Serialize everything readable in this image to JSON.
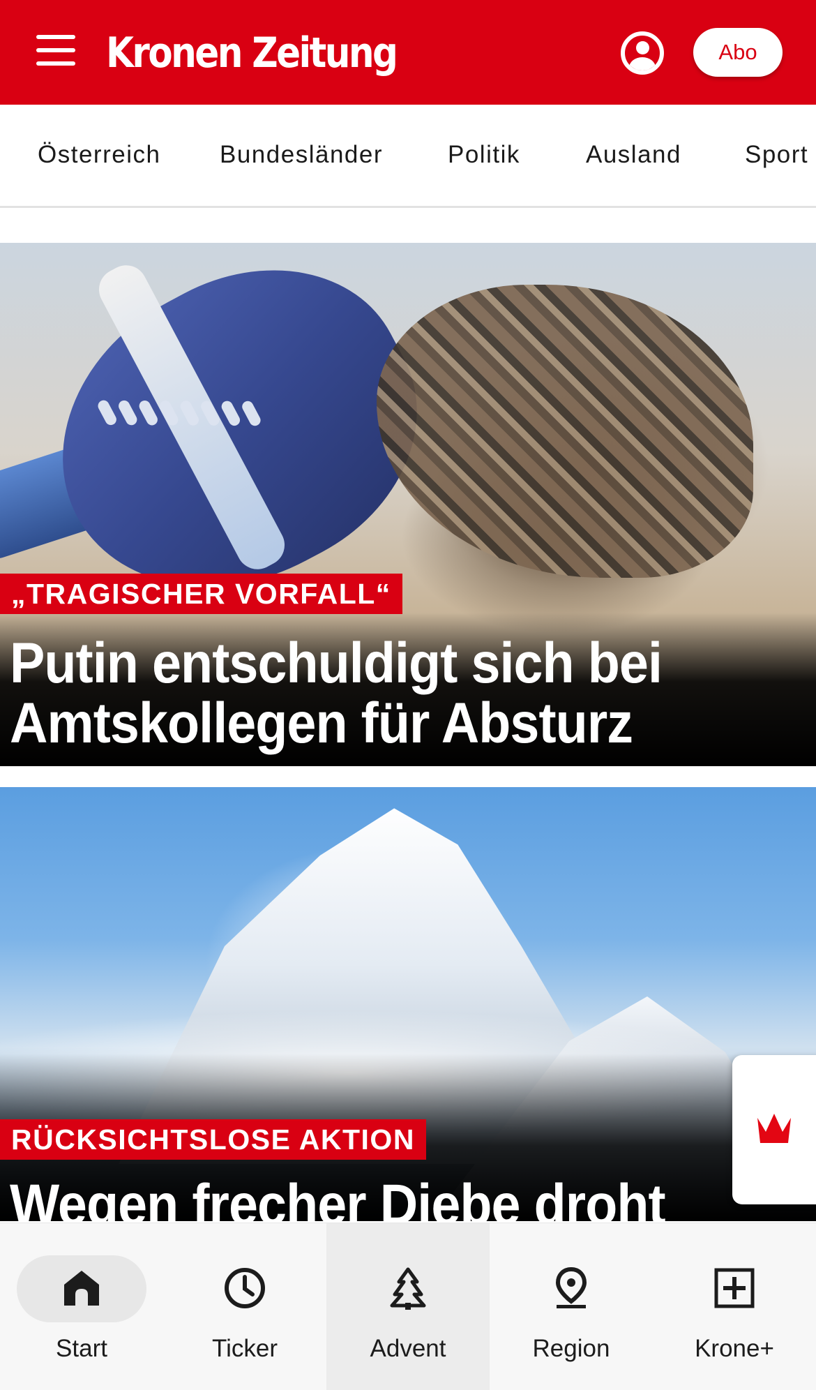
{
  "header": {
    "brand": "Kronen Zeitung",
    "abo_label": "Abo",
    "brand_color": "#d90012",
    "icons": [
      "menu-icon",
      "user-account-icon"
    ]
  },
  "categories": [
    "Österreich",
    "Bundesländer",
    "Politik",
    "Ausland",
    "Sport"
  ],
  "articles": [
    {
      "kicker": "„TRAGISCHER VORFALL“",
      "headline": "Putin entschuldigt sich bei Amtskollegen für Absturz"
    },
    {
      "kicker": "RÜCKSICHTSLOSE AKTION",
      "headline": "Wegen frecher Diebe droht"
    }
  ],
  "floating_button": {
    "icon": "krone-crown-icon"
  },
  "tabbar": {
    "items": [
      {
        "label": "Start",
        "icon": "home-icon",
        "active": true
      },
      {
        "label": "Ticker",
        "icon": "clock-icon"
      },
      {
        "label": "Advent",
        "icon": "tree-icon"
      },
      {
        "label": "Region",
        "icon": "location-pin-icon"
      },
      {
        "label": "Krone+",
        "icon": "plus-box-icon"
      }
    ]
  }
}
